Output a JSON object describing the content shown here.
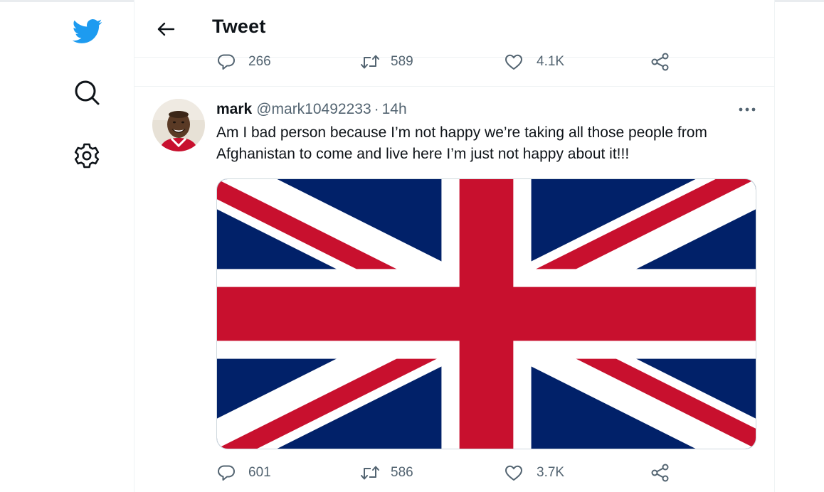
{
  "header": {
    "title": "Tweet"
  },
  "previous_tweet": {
    "replies": "266",
    "retweets": "589",
    "likes": "4.1K"
  },
  "tweet": {
    "author_name": "mark",
    "author_handle": "@mark10492233",
    "separator": "·",
    "time": "14h",
    "text": "Am I bad person because I’m not happy we’re taking all those people from Afghanistan to come and live here I’m just not happy about it!!!",
    "replies": "601",
    "retweets": "586",
    "likes": "3.7K"
  },
  "icons": {
    "logo": "twitter-bird-icon",
    "search": "search-icon",
    "settings": "gear-icon",
    "back": "arrow-left-icon",
    "more": "more-horizontal-icon",
    "reply": "speech-bubble-icon",
    "retweet": "retweet-icon",
    "like": "heart-icon",
    "share": "share-icon"
  },
  "colors": {
    "brand": "#1d9bf0",
    "secondary_text": "#536471",
    "flag_blue": "#012169",
    "flag_red": "#c8102e"
  }
}
